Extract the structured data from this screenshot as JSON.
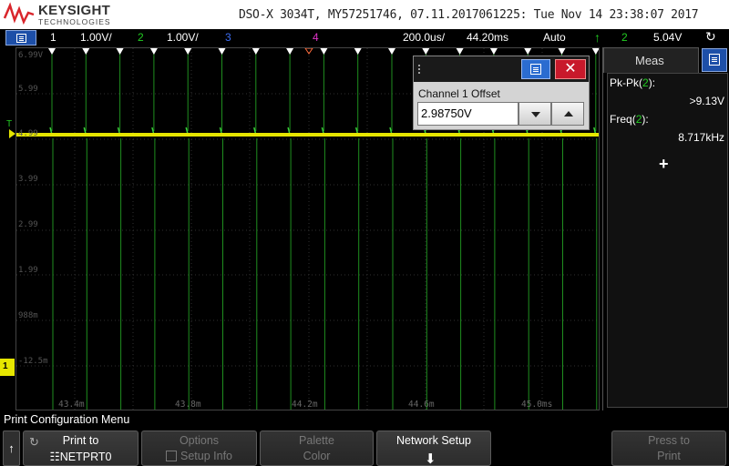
{
  "header": {
    "brand": "KEYSIGHT",
    "brand_sub": "TECHNOLOGIES",
    "info": "DSO-X 3034T, MY57251746, 07.11.2017061225: Tue Nov 14 23:38:07 2017"
  },
  "status": {
    "ch1_num": "1",
    "ch1_scale": "1.00V/",
    "ch2_num": "2",
    "ch2_scale": "1.00V/",
    "ch3_num": "3",
    "ch4_num": "4",
    "timebase": "200.0us/",
    "delay": "44.20ms",
    "trigger_mode": "Auto",
    "trigger_icon": "rising-edge-icon",
    "trigger_ch": "2",
    "trigger_level": "5.04V",
    "colors": {
      "ch1": "#e6e600",
      "ch2": "#22cc22",
      "ch3": "#3d6df2",
      "ch4": "#e033c8",
      "accent_blue": "#1d4fa8"
    }
  },
  "graticule": {
    "y_labels": [
      "6.99V",
      "5.99",
      "4.99",
      "3.99",
      "2.99",
      "1.99",
      "988m",
      "-12.5m"
    ],
    "x_labels": [
      "43.4m",
      "43.8m",
      "44.2m",
      "44.6m",
      "45.0ms"
    ],
    "ch1_marker": "1",
    "trigger_marker": "T"
  },
  "offset_dialog": {
    "label": "Channel 1 Offset",
    "value": "2.98750V"
  },
  "side_panel": {
    "tab_label": "Meas",
    "measurements": [
      {
        "name": "Pk-Pk",
        "ch": "2",
        "value": ">9.13V"
      },
      {
        "name": "Freq",
        "ch": "2",
        "value": "8.717kHz"
      }
    ],
    "add_label": "+"
  },
  "softkeys": {
    "menu_title": "Print Configuration Menu",
    "back_icon": "up-arrow-icon",
    "print_to_l1": "Print to",
    "print_to_l2": "NETPRT0",
    "options_l1": "Options",
    "options_l2": "Setup Info",
    "palette_l1": "Palette",
    "palette_l2": "Color",
    "network_l1": "Network Setup",
    "press_l1": "Press to",
    "press_l2": "Print"
  }
}
